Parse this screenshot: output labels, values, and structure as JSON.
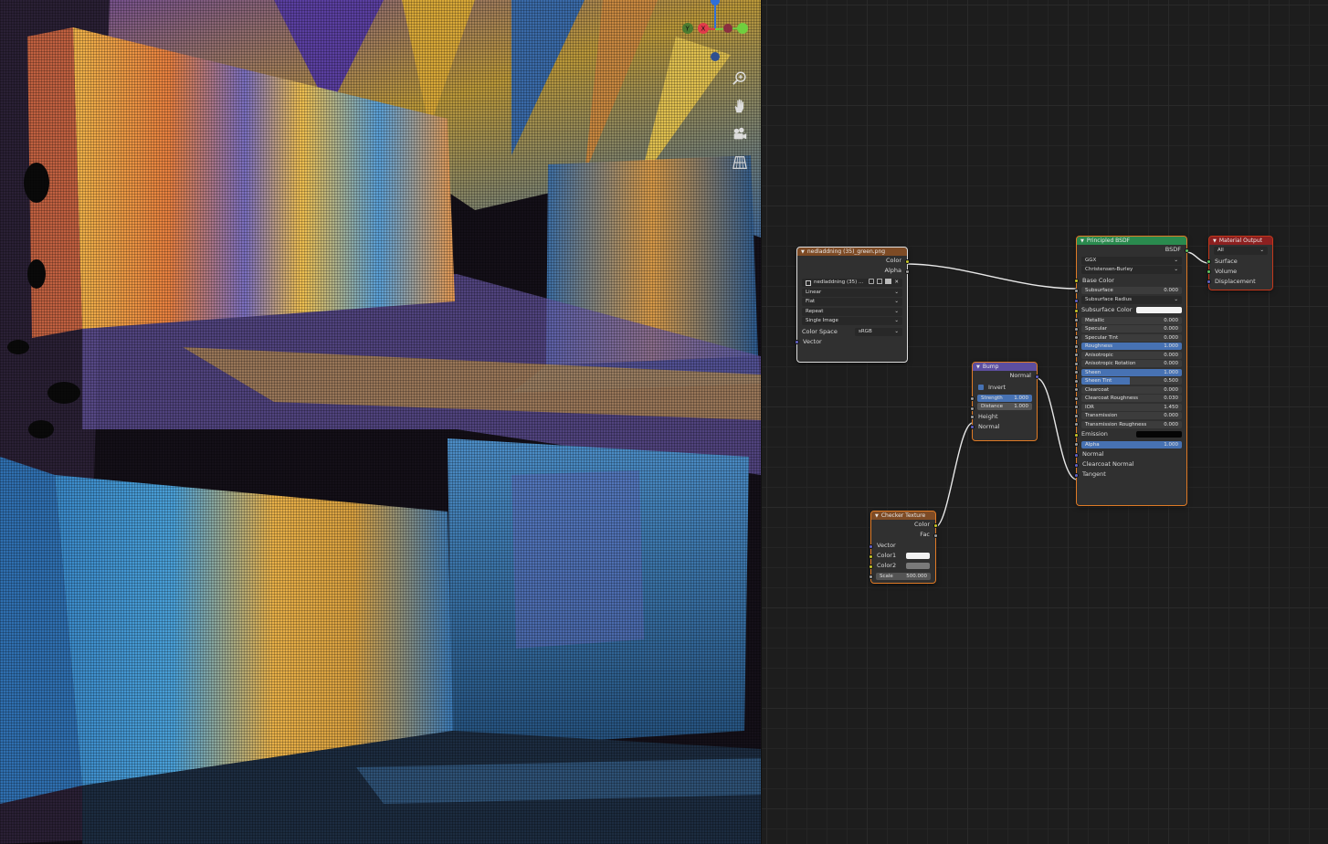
{
  "viewport": {
    "gizmo": {
      "y_label": "Y",
      "x_label": "X"
    },
    "nav_icons": [
      "zoom-icon",
      "pan-hand-icon",
      "camera-icon",
      "ortho-grid-icon"
    ]
  },
  "nodes": {
    "image_texture": {
      "title": "nedladdning (35)_green.png",
      "outputs": {
        "color": "Color",
        "alpha": "Alpha"
      },
      "image_name": "nedladdning (35) ...",
      "interpolation": "Linear",
      "projection": "Flat",
      "extension": "Repeat",
      "source": "Single Image",
      "color_space_label": "Color Space",
      "color_space_value": "sRGB",
      "inputs": {
        "vector": "Vector"
      }
    },
    "bump": {
      "title": "Bump",
      "output_normal": "Normal",
      "invert_label": "Invert",
      "strength_label": "Strength",
      "strength_value": "1.000",
      "distance_label": "Distance",
      "distance_value": "1.000",
      "height_label": "Height",
      "normal_label": "Normal"
    },
    "checker": {
      "title": "Checker Texture",
      "output_color": "Color",
      "output_fac": "Fac",
      "vector_label": "Vector",
      "color1_label": "Color1",
      "color2_label": "Color2",
      "scale_label": "Scale",
      "scale_value": "500.000"
    },
    "principled": {
      "title": "Principled BSDF",
      "output": "BSDF",
      "distribution": "GGX",
      "subsurface_method": "Christensen-Burley",
      "base_color": "Base Color",
      "fields": [
        {
          "label": "Subsurface",
          "value": "0.000"
        },
        {
          "label": "Subsurface Radius",
          "value": ""
        },
        {
          "label": "Subsurface Color",
          "value": ""
        },
        {
          "label": "Metallic",
          "value": "0.000"
        },
        {
          "label": "Specular",
          "value": "0.000"
        },
        {
          "label": "Specular Tint",
          "value": "0.000"
        },
        {
          "label": "Roughness",
          "value": "1.000"
        },
        {
          "label": "Anisotropic",
          "value": "0.000"
        },
        {
          "label": "Anisotropic Rotation",
          "value": "0.000"
        },
        {
          "label": "Sheen",
          "value": "1.000"
        },
        {
          "label": "Sheen Tint",
          "value": "0.500"
        },
        {
          "label": "Clearcoat",
          "value": "0.000"
        },
        {
          "label": "Clearcoat Roughness",
          "value": "0.030"
        },
        {
          "label": "IOR",
          "value": "1.450"
        },
        {
          "label": "Transmission",
          "value": "0.000"
        },
        {
          "label": "Transmission Roughness",
          "value": "0.000"
        },
        {
          "label": "Emission",
          "value": ""
        },
        {
          "label": "Alpha",
          "value": "1.000"
        }
      ],
      "normal": "Normal",
      "clearcoat_normal": "Clearcoat Normal",
      "tangent": "Tangent"
    },
    "material_output": {
      "title": "Material Output",
      "target": "All",
      "surface": "Surface",
      "volume": "Volume",
      "displacement": "Displacement"
    }
  },
  "colors": {
    "texture_header": "#7e4b25",
    "bump_header": "#5c4ea0",
    "shader_header": "#2a8a4e",
    "output_header": "#8c2020",
    "selection_orange": "#e07b26",
    "field_blue": "#4772b3"
  }
}
